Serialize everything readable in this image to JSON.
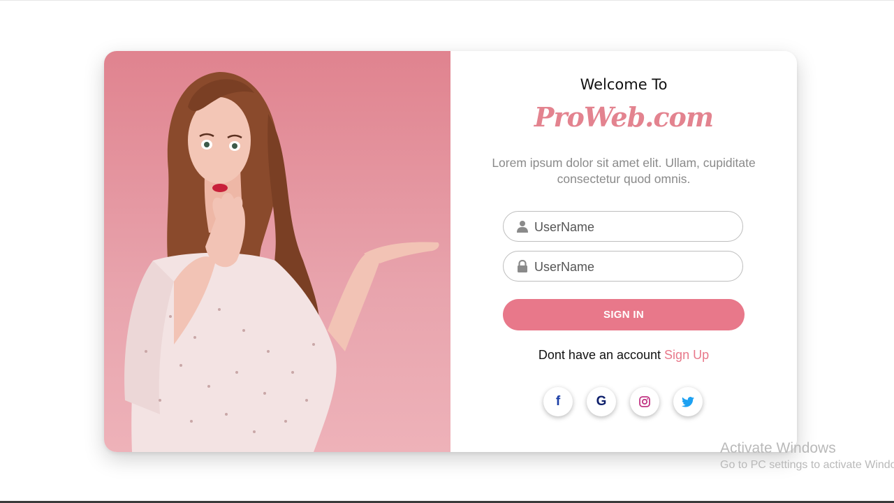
{
  "card": {
    "welcome": "Welcome To",
    "brand": "ProWeb.com",
    "description": "Lorem ipsum dolor sit amet elit. Ullam, cupiditate consectetur quod omnis.",
    "username": {
      "placeholder": "UserName",
      "value": ""
    },
    "password": {
      "placeholder": "UserName",
      "value": ""
    },
    "signin_label": "SIGN IN",
    "account_text": "Dont have an account",
    "signup_link": "Sign Up",
    "social": [
      "facebook-icon",
      "google-icon",
      "instagram-icon",
      "twitter-icon"
    ]
  },
  "watermark": {
    "line1": "Activate Windows",
    "line2": "Go to PC settings to activate Windows."
  },
  "colors": {
    "accent": "#e8788a",
    "brand": "#e3838f",
    "panel_bg": "#e0838f"
  }
}
